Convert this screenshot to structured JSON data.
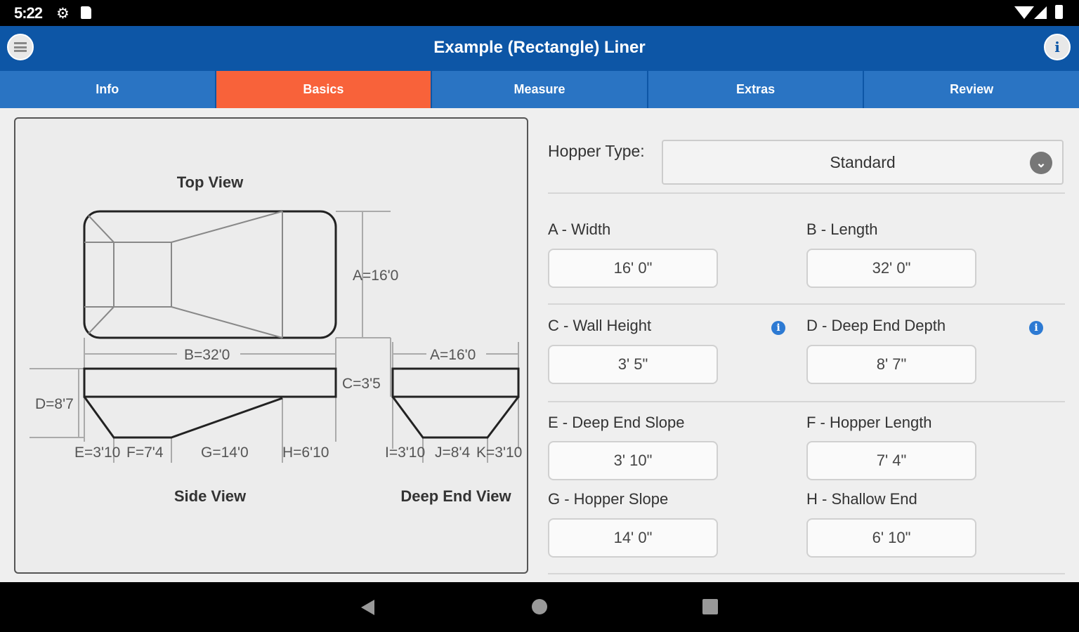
{
  "status_bar": {
    "time": "5:22",
    "icons": [
      "gear-icon",
      "sd-card-icon",
      "wifi-icon",
      "cell-signal-icon",
      "battery-icon"
    ]
  },
  "app_bar": {
    "title": "Example (Rectangle) Liner",
    "menu_icon": "menu-icon",
    "info_icon": "info-icon"
  },
  "tabs": [
    {
      "label": "Info",
      "active": false
    },
    {
      "label": "Basics",
      "active": true
    },
    {
      "label": "Measure",
      "active": false
    },
    {
      "label": "Extras",
      "active": false
    },
    {
      "label": "Review",
      "active": false
    }
  ],
  "diagram": {
    "top_view_title": "Top View",
    "side_view_title": "Side View",
    "deep_end_view_title": "Deep End View",
    "labels": {
      "a_top": "A=16'0",
      "b": "B=32'0",
      "a_end": "A=16'0",
      "c": "C=3'5",
      "d": "D=8'7",
      "e": "E=3'10",
      "f": "F=7'4",
      "g": "G=14'0",
      "h": "H=6'10",
      "i": "I=3'10",
      "j": "J=8'4",
      "k": "K=3'10"
    }
  },
  "form": {
    "hopper_type_label": "Hopper Type:",
    "hopper_type_value": "Standard",
    "fields": [
      {
        "label": "A - Width",
        "value": "16' 0\""
      },
      {
        "label": "B - Length",
        "value": "32' 0\""
      },
      {
        "label": "C - Wall Height",
        "value": "3' 5\""
      },
      {
        "label": "D - Deep End Depth",
        "value": "8' 7\""
      },
      {
        "label": "E - Deep End Slope",
        "value": "3' 10\""
      },
      {
        "label": "F - Hopper Length",
        "value": "7' 4\""
      },
      {
        "label": "G - Hopper Slope",
        "value": "14' 0\""
      },
      {
        "label": "H - Shallow End",
        "value": "6' 10\""
      }
    ]
  },
  "colors": {
    "app_bar": "#0d56a6",
    "tab": "#2a74c3",
    "tab_active": "#f8623a",
    "info_icon": "#2d7ad3"
  }
}
